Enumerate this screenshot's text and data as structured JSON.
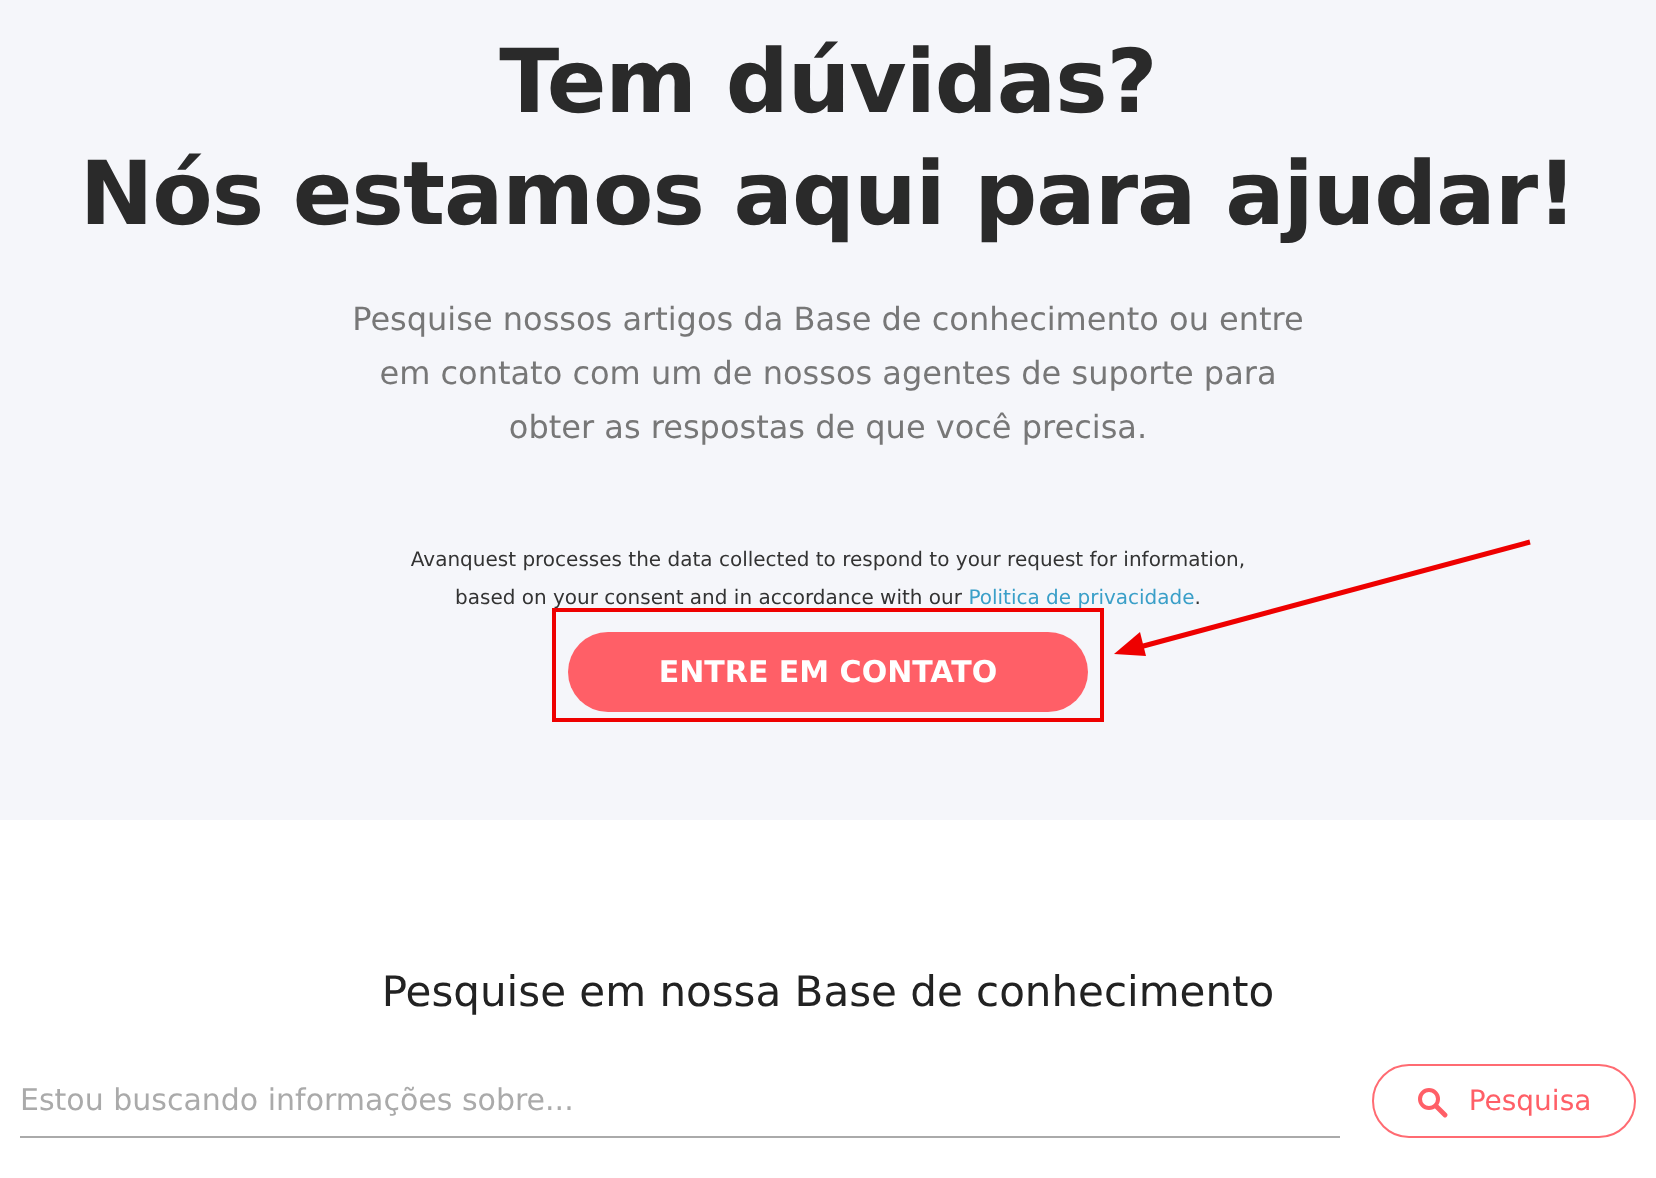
{
  "hero": {
    "title_lines": [
      "Tem dúvidas?",
      "Nós estamos aqui para ajudar!"
    ],
    "intro_lines": [
      "Pesquise nossos artigos da Base de conhecimento ou entre",
      "em contato com um de nossos agentes de suporte para",
      "obter as respostas de que você precisa."
    ],
    "consent_line_1": "Avanquest processes the data collected to respond to your request for information,",
    "consent_line_2": "based on your consent and in accordance with our",
    "privacy_link": "Politica de privacidade",
    "consent_end": ".",
    "contact_button": "ENTRE EM CONTATO"
  },
  "knowledge_base": {
    "title": "Pesquise em nossa Base de conhecimento",
    "search": {
      "placeholder": "Estou buscando informações sobre..."
    },
    "search_button": "Pesquisa"
  }
}
